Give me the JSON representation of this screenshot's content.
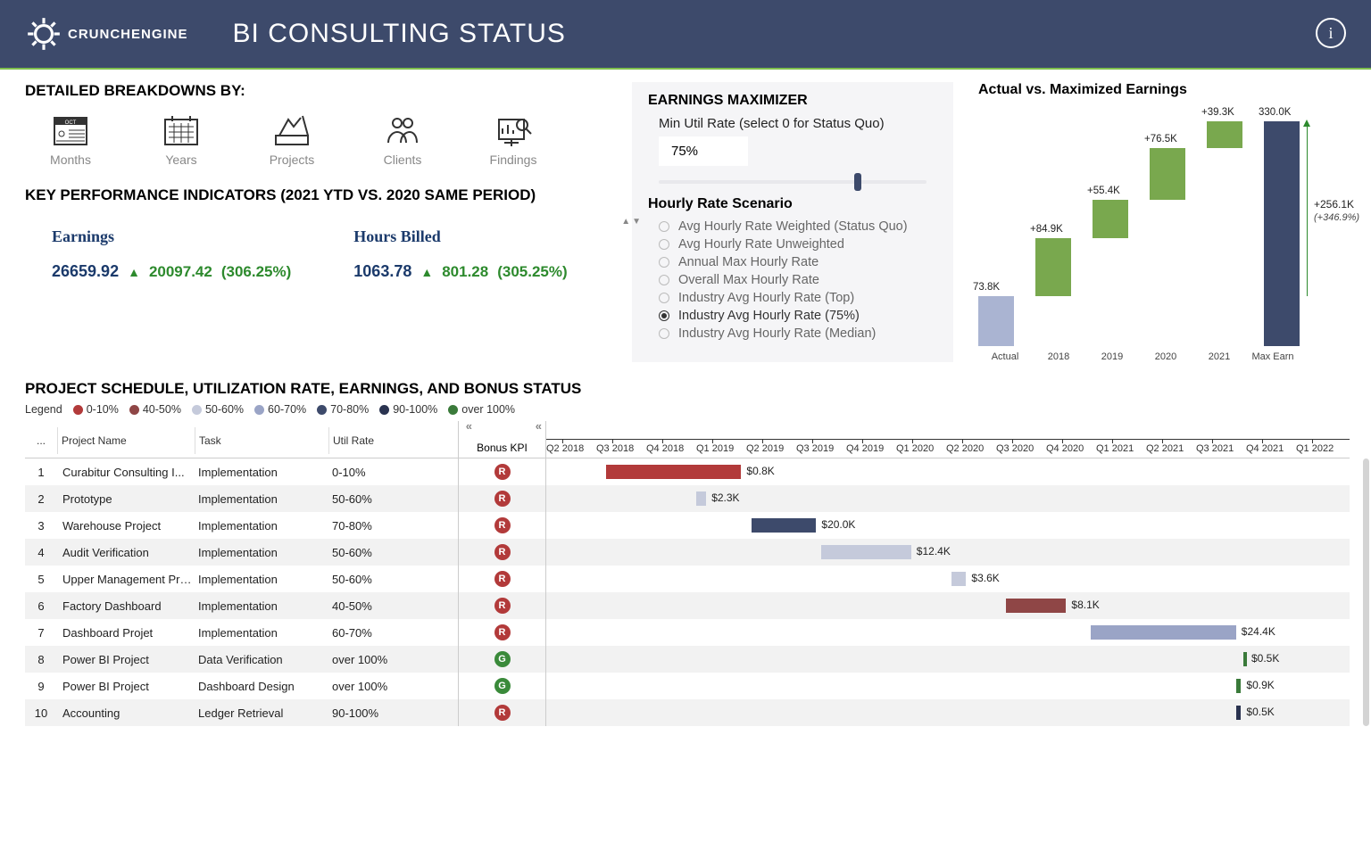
{
  "header": {
    "brand": "CRUNCHENGINE",
    "title": "BI CONSULTING STATUS"
  },
  "breakdowns": {
    "title": "DETAILED BREAKDOWNS BY:",
    "items": [
      "Months",
      "Years",
      "Projects",
      "Clients",
      "Findings"
    ]
  },
  "kpi": {
    "title": "KEY PERFORMANCE INDICATORS (2021 YTD VS. 2020 SAME PERIOD)",
    "cards": [
      {
        "name": "Earnings",
        "current": "26659.92",
        "prev": "20097.42",
        "pct": "(306.25%)"
      },
      {
        "name": "Hours Billed",
        "current": "1063.78",
        "prev": "801.28",
        "pct": "(305.25%)"
      }
    ]
  },
  "maximizer": {
    "title": "EARNINGS MAXIMIZER",
    "sub": "Min Util Rate (select 0 for Status Quo)",
    "value": "75%",
    "slider_pos": 0.73,
    "rate_title": "Hourly Rate Scenario",
    "options": [
      "Avg Hourly Rate Weighted (Status Quo)",
      "Avg Hourly Rate Unweighted",
      "Annual Max Hourly Rate",
      "Overall Max Hourly Rate",
      "Industry Avg Hourly Rate (Top)",
      "Industry Avg Hourly Rate (75%)",
      "Industry Avg Hourly Rate (Median)"
    ],
    "selected": 5
  },
  "chart_data": {
    "type": "waterfall",
    "title": "Actual vs. Maximized Earnings",
    "categories": [
      "Actual",
      "2018",
      "2019",
      "2020",
      "2021",
      "Max Earn"
    ],
    "values": [
      73.8,
      84.9,
      55.4,
      76.5,
      39.3,
      330.0
    ],
    "labels": [
      "73.8K",
      "+84.9K",
      "+55.4K",
      "+76.5K",
      "+39.3K",
      "330.0K"
    ],
    "total_change": "+256.1K",
    "total_pct": "(+346.9%)",
    "ylim": [
      0,
      340
    ]
  },
  "schedule": {
    "title": "PROJECT SCHEDULE, UTILIZATION RATE, EARNINGS, AND BONUS STATUS",
    "legend_label": "Legend",
    "legend": [
      {
        "name": "0-10%",
        "color": "#b23a3a"
      },
      {
        "name": "40-50%",
        "color": "#8f4646"
      },
      {
        "name": "50-60%",
        "color": "#c5cadb"
      },
      {
        "name": "60-70%",
        "color": "#9aa4c6"
      },
      {
        "name": "70-80%",
        "color": "#3d4a6b"
      },
      {
        "name": "90-100%",
        "color": "#2a3350"
      },
      {
        "name": "over 100%",
        "color": "#3a7a3a"
      }
    ],
    "headers": {
      "num": "...",
      "project": "Project Name",
      "task": "Task",
      "util": "Util Rate",
      "bonus": "Bonus KPI"
    },
    "timeline": [
      "Q2 2018",
      "Q3 2018",
      "Q4 2018",
      "Q1 2019",
      "Q2 2019",
      "Q3 2019",
      "Q4 2019",
      "Q1 2020",
      "Q2 2020",
      "Q3 2020",
      "Q4 2020",
      "Q1 2021",
      "Q2 2021",
      "Q3 2021",
      "Q4 2021",
      "Q1 2022"
    ],
    "rows": [
      {
        "n": 1,
        "project": "Curabitur Consulting I...",
        "task": "Implementation",
        "util": "0-10%",
        "bonus": "R",
        "bar_start": 1.2,
        "bar_end": 3.9,
        "color": "#b23a3a",
        "val": "$0.8K"
      },
      {
        "n": 2,
        "project": "Prototype",
        "task": "Implementation",
        "util": "50-60%",
        "bonus": "R",
        "bar_start": 3.0,
        "bar_end": 3.2,
        "color": "#c5cadb",
        "val": "$2.3K"
      },
      {
        "n": 3,
        "project": "Warehouse Project",
        "task": "Implementation",
        "util": "70-80%",
        "bonus": "R",
        "bar_start": 4.1,
        "bar_end": 5.4,
        "color": "#3d4a6b",
        "val": "$20.0K"
      },
      {
        "n": 4,
        "project": "Audit Verification",
        "task": "Implementation",
        "util": "50-60%",
        "bonus": "R",
        "bar_start": 5.5,
        "bar_end": 7.3,
        "color": "#c5cadb",
        "val": "$12.4K"
      },
      {
        "n": 5,
        "project": "Upper Management Pro...",
        "task": "Implementation",
        "util": "50-60%",
        "bonus": "R",
        "bar_start": 8.1,
        "bar_end": 8.4,
        "color": "#c5cadb",
        "val": "$3.6K"
      },
      {
        "n": 6,
        "project": "Factory Dashboard",
        "task": "Implementation",
        "util": "40-50%",
        "bonus": "R",
        "bar_start": 9.2,
        "bar_end": 10.4,
        "color": "#8f4646",
        "val": "$8.1K"
      },
      {
        "n": 7,
        "project": "Dashboard Projet",
        "task": "Implementation",
        "util": "60-70%",
        "bonus": "R",
        "bar_start": 10.9,
        "bar_end": 13.8,
        "color": "#9aa4c6",
        "val": "$24.4K"
      },
      {
        "n": 8,
        "project": "Power BI Project",
        "task": "Data Verification",
        "util": "over 100%",
        "bonus": "G",
        "bar_start": 13.95,
        "bar_end": 14.0,
        "color": "#3a7a3a",
        "val": "$0.5K"
      },
      {
        "n": 9,
        "project": "Power BI Project",
        "task": "Dashboard Design",
        "util": "over 100%",
        "bonus": "G",
        "bar_start": 13.8,
        "bar_end": 13.9,
        "color": "#3a7a3a",
        "val": "$0.9K"
      },
      {
        "n": 10,
        "project": "Accounting",
        "task": "Ledger Retrieval",
        "util": "90-100%",
        "bonus": "R",
        "bar_start": 13.8,
        "bar_end": 13.9,
        "color": "#2a3350",
        "val": "$0.5K"
      }
    ]
  }
}
